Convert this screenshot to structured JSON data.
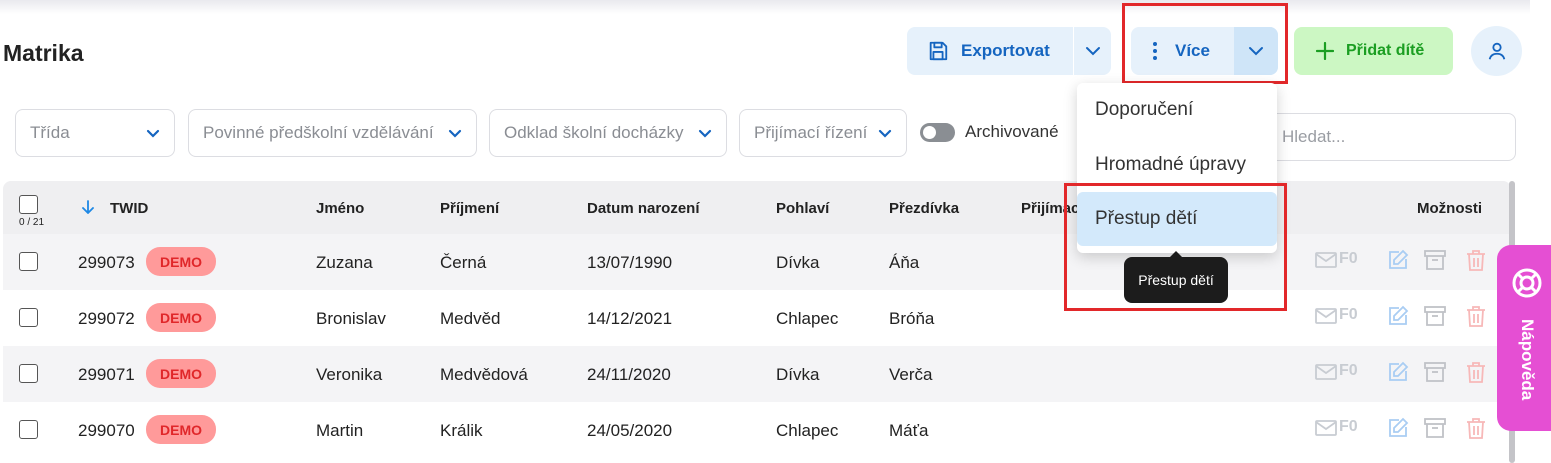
{
  "page": {
    "title": "Matrika"
  },
  "header": {
    "export_label": "Exportovat",
    "more_label": "Více",
    "add_label": "Přidat dítě"
  },
  "filters": {
    "class_placeholder": "Třída",
    "mandatory_preschool": "Povinné předškolní vzdělávání",
    "postponement": "Odklad školní docházky",
    "admission": "Přijímací řízení",
    "archived_label": "Archivované",
    "search_placeholder": "Hledat..."
  },
  "table": {
    "selection_count": "0 / 21",
    "columns": {
      "twid": "TWID",
      "first_name": "Jméno",
      "last_name": "Příjmení",
      "birth_date": "Datum narození",
      "gender": "Pohlaví",
      "nickname": "Přezdívka",
      "admission": "Přijímac",
      "options": "Možnosti"
    },
    "rows": [
      {
        "twid": "299073",
        "badge": "DEMO",
        "first_name": "Zuzana",
        "last_name": "Černá",
        "birth_date": "13/07/1990",
        "gender": "Dívka",
        "nickname": "Áňa",
        "mail_count": "F0"
      },
      {
        "twid": "299072",
        "badge": "DEMO",
        "first_name": "Bronislav",
        "last_name": "Medvěd",
        "birth_date": "14/12/2021",
        "gender": "Chlapec",
        "nickname": "Bróňa",
        "mail_count": "F0"
      },
      {
        "twid": "299071",
        "badge": "DEMO",
        "first_name": "Veronika",
        "last_name": "Medvědová",
        "birth_date": "24/11/2020",
        "gender": "Dívka",
        "nickname": "Verča",
        "mail_count": "F0"
      },
      {
        "twid": "299070",
        "badge": "DEMO",
        "first_name": "Martin",
        "last_name": "Králik",
        "birth_date": "24/05/2020",
        "gender": "Chlapec",
        "nickname": "Máťa",
        "mail_count": "F0"
      }
    ]
  },
  "more_menu": {
    "items": [
      "Doporučení",
      "Hromadné úpravy",
      "Přestup dětí"
    ],
    "active_index": 2,
    "tooltip": "Přestup dětí"
  },
  "help": {
    "label": "Nápověda"
  },
  "colors": {
    "primary": "#1565c0",
    "success": "#1b9e22",
    "demo_badge": "#ff9a9a",
    "help_tab": "#e54fd3",
    "highlight_border": "#e2282a"
  },
  "icons": {
    "export": "save-icon",
    "more": "kebab-icon",
    "add": "plus-icon",
    "user": "user-icon",
    "sort": "arrow-down-icon",
    "row_actions": [
      "mail-icon",
      "edit-icon",
      "archive-icon",
      "trash-icon"
    ],
    "help": "lifebuoy-icon"
  }
}
